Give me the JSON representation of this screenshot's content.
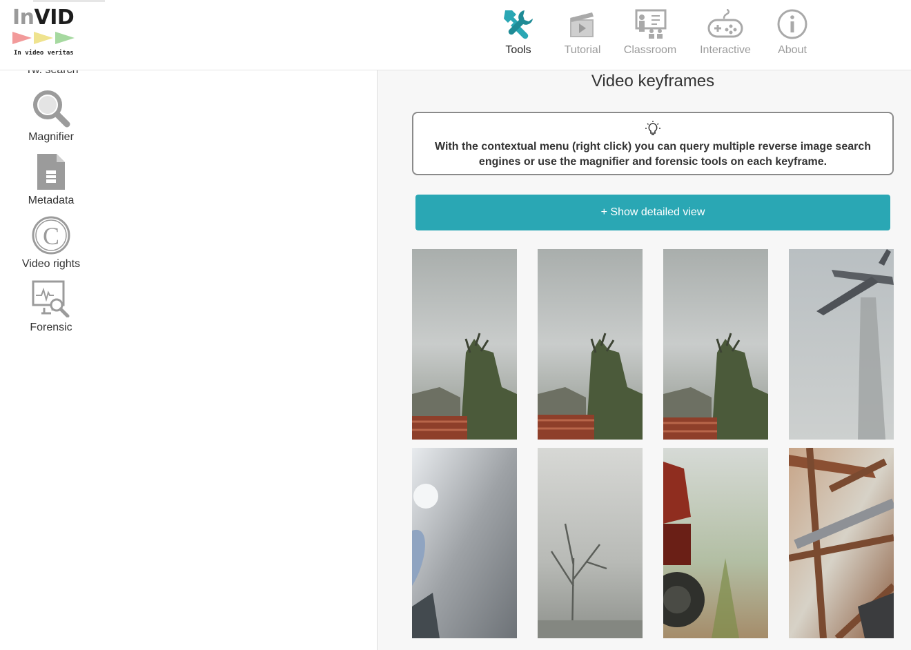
{
  "logo": {
    "title_prefix": "In",
    "title_suffix": "VID",
    "tagline": "In video veritas"
  },
  "nav": [
    {
      "label": "Tools",
      "icon": "tools-icon",
      "active": true
    },
    {
      "label": "Tutorial",
      "icon": "clapperboard-icon",
      "active": false
    },
    {
      "label": "Classroom",
      "icon": "classroom-icon",
      "active": false
    },
    {
      "label": "Interactive",
      "icon": "gamepad-icon",
      "active": false
    },
    {
      "label": "About",
      "icon": "info-icon",
      "active": false
    }
  ],
  "sidebar": {
    "cut_item": "Tw. search",
    "items": [
      {
        "label": "Magnifier",
        "icon": "magnifier-icon"
      },
      {
        "label": "Metadata",
        "icon": "metadata-file-icon"
      },
      {
        "label": "Video rights",
        "icon": "copyright-icon"
      },
      {
        "label": "Forensic",
        "icon": "forensic-icon"
      }
    ]
  },
  "main": {
    "title": "Video keyframes",
    "tip": "With the contextual menu (right click) you can query multiple reverse image search engines or use the magnifier and forensic tools on each keyframe.",
    "detail_button": "+ Show detailed view",
    "keyframe_count": 8
  },
  "colors": {
    "accent": "#2aa7b4",
    "active_icon": "#2aa7b4",
    "inactive_icon": "#a9a9a9"
  }
}
